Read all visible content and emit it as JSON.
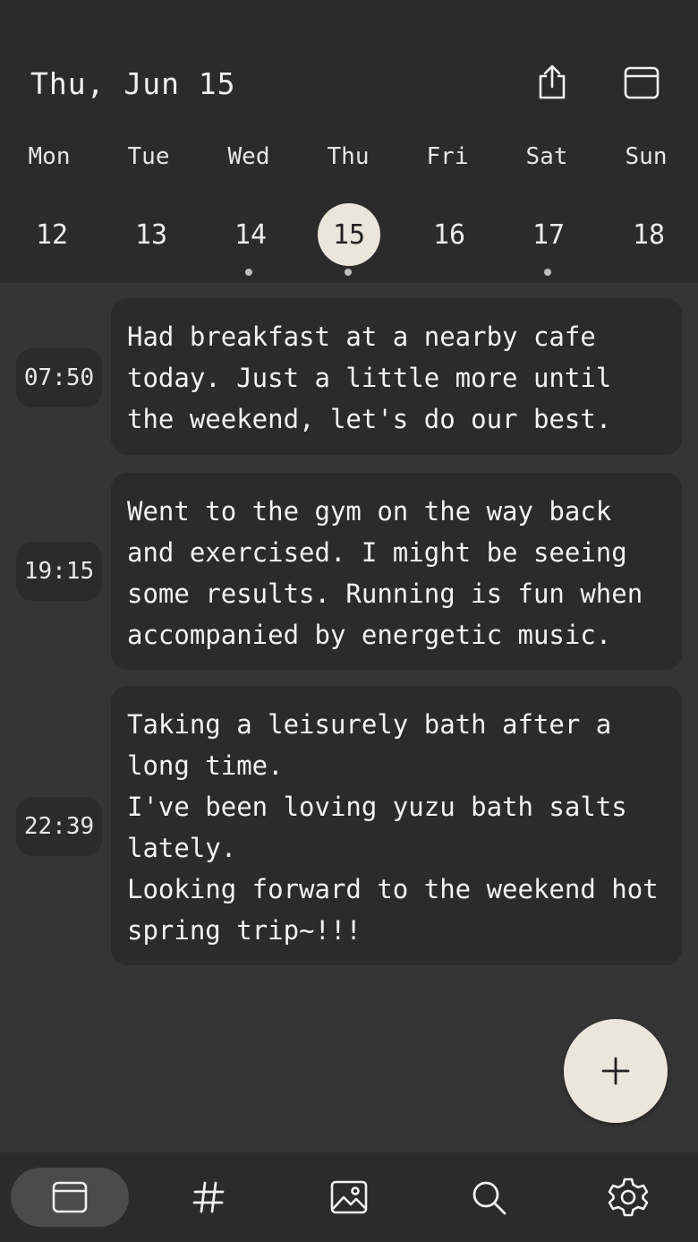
{
  "header": {
    "date_title": "Thu, Jun 15",
    "share_icon": "share-icon",
    "calendar_icon": "calendar-icon"
  },
  "week": {
    "days": [
      {
        "weekday": "Mon",
        "number": "12",
        "selected": false,
        "has_entry": false
      },
      {
        "weekday": "Tue",
        "number": "13",
        "selected": false,
        "has_entry": false
      },
      {
        "weekday": "Wed",
        "number": "14",
        "selected": false,
        "has_entry": true
      },
      {
        "weekday": "Thu",
        "number": "15",
        "selected": true,
        "has_entry": true
      },
      {
        "weekday": "Fri",
        "number": "16",
        "selected": false,
        "has_entry": false
      },
      {
        "weekday": "Sat",
        "number": "17",
        "selected": false,
        "has_entry": true
      },
      {
        "weekday": "Sun",
        "number": "18",
        "selected": false,
        "has_entry": false
      }
    ]
  },
  "entries": [
    {
      "time": "07:50",
      "text": "Had breakfast at a nearby cafe today. Just a little more until the weekend, let's do our best."
    },
    {
      "time": "19:15",
      "text": "Went to the gym on the way back and exercised. I might be seeing some results. Running is fun when accompanied by energetic music."
    },
    {
      "time": "22:39",
      "text": "Taking a leisurely bath after a long time.\nI've been loving yuzu bath salts lately.\nLooking forward to the weekend hot spring trip~!!!"
    }
  ],
  "fab": {
    "icon": "plus-icon"
  },
  "bottom_nav": {
    "items": [
      {
        "icon": "diary-icon",
        "active": true
      },
      {
        "icon": "hashtag-icon",
        "active": false
      },
      {
        "icon": "image-icon",
        "active": false
      },
      {
        "icon": "search-icon",
        "active": false
      },
      {
        "icon": "settings-icon",
        "active": false
      }
    ]
  },
  "colors": {
    "background": "#353535",
    "surface": "#2b2b2b",
    "accent": "#ebe6dc",
    "text": "#f2f2f2"
  }
}
